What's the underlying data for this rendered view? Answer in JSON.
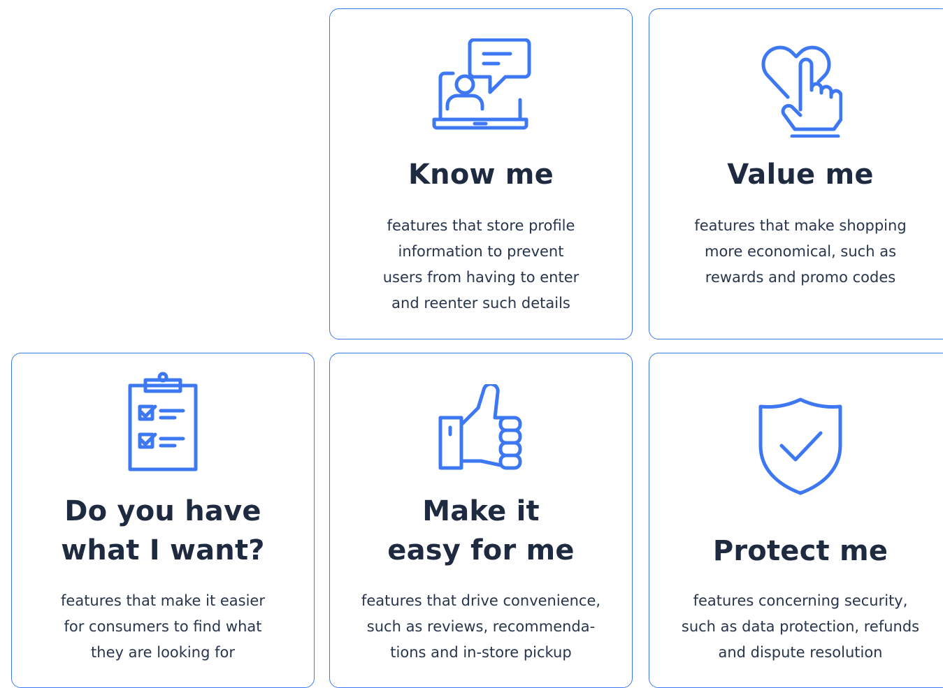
{
  "accent_color": "#3d78f2",
  "cards": [
    {
      "title": "Know me",
      "icon": "laptop-chat-icon",
      "description": [
        "features that store profile",
        "information to prevent",
        "users from having to enter",
        "and reenter such details"
      ]
    },
    {
      "title": "Value me",
      "icon": "heart-hand-icon",
      "description": [
        "features that make shopping",
        "more economical, such as",
        "rewards and promo codes"
      ]
    },
    {
      "title_lines": [
        "Do you have",
        "what I want?"
      ],
      "icon": "clipboard-checklist-icon",
      "description": [
        "features that make it easier",
        "for consumers to find what",
        "they are looking for"
      ]
    },
    {
      "title_lines": [
        "Make it",
        "easy for me"
      ],
      "icon": "thumbs-up-icon",
      "description": [
        "features that drive convenience,",
        "such as reviews, recommenda-",
        "tions and in-store pickup"
      ]
    },
    {
      "title": "Protect me",
      "icon": "shield-check-icon",
      "description": [
        "features concerning security,",
        "such as data protection, refunds",
        "and dispute resolution"
      ]
    }
  ]
}
